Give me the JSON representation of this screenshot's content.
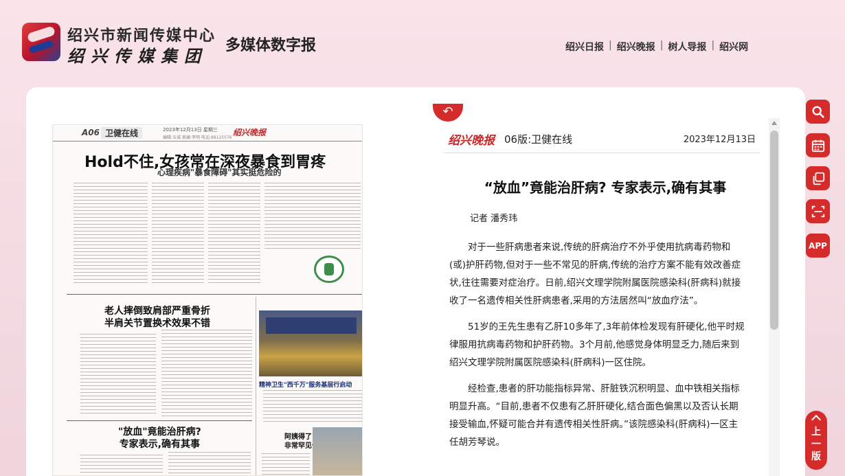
{
  "header": {
    "org_name": "绍兴市新闻传媒中心",
    "group_name": "绍兴传媒集团",
    "site_name": "多媒体数字报",
    "nav": [
      "绍兴日报",
      "绍兴晚报",
      "树人导报",
      "绍兴网"
    ]
  },
  "newspaper": {
    "page_no": "A06",
    "section": "卫健在线",
    "date_line": "2023年12月13日 星期三",
    "masthead": "绍兴晚报",
    "editor_line": "编辑:五城 美编:李明 电话:88125576",
    "headline_main": "Hold不住,女孩常在深夜暴食到胃疼",
    "headline_main_sub": "心理疾病\"暴食障碍\"其实挺危险的",
    "headline_2_l1": "老人摔倒致肩部严重骨折",
    "headline_2_l2": "半肩关节置换术效果不错",
    "headline_3_l1": "\"放血\"竟能治肝病?",
    "headline_3_l2": "专家表示,确有其事",
    "headline_4_l1": "阿姨得了\"鹿贝病\"",
    "headline_4_l2": "非常罕见但能治",
    "photo_caption": "精神卫生\"西千万\"服务基层行启动"
  },
  "article": {
    "masthead": "绍兴晚报",
    "page_label": "06版:卫健在线",
    "date": "2023年12月13日",
    "title": "“放血”竟能治肝病? 专家表示,确有其事",
    "author": "记者 潘秀玮",
    "paragraphs": [
      "对于一些肝病患者来说,传统的肝病治疗不外乎使用抗病毒药物和(或)护肝药物,但对于一些不常见的肝病,传统的治疗方案不能有效改善症状,往往需要对症治疗。日前,绍兴文理学院附属医院感染科(肝病科)就接收了一名遗传相关性肝病患者,采用的方法居然叫“放血疗法”。",
      "51岁的王先生患有乙肝10多年了,3年前体检发现有肝硬化,他平时规律服用抗病毒药物和护肝药物。3个月前,他感觉身体明显乏力,随后来到绍兴文理学院附属医院感染科(肝病科)一区住院。",
      "经检查,患者的肝功能指标异常、肝脏铁沉积明显、血中铁相关指标明显升高。“目前,患者不仅患有乙肝肝硬化,结合面色偏黑以及否认长期接受输血,怀疑可能合并有遗传相关性肝病。”该院感染科(肝病科)一区主任胡芳琴说。"
    ]
  },
  "tools": [
    "search-icon",
    "calendar-icon",
    "copy-icon",
    "scan-icon",
    "app-icon"
  ],
  "tool_app_label": "APP",
  "prev_page": {
    "l1": "上",
    "l2": "一",
    "l3": "版"
  },
  "colors": {
    "accent": "#d62b2b",
    "bg": "#f6dde4"
  }
}
